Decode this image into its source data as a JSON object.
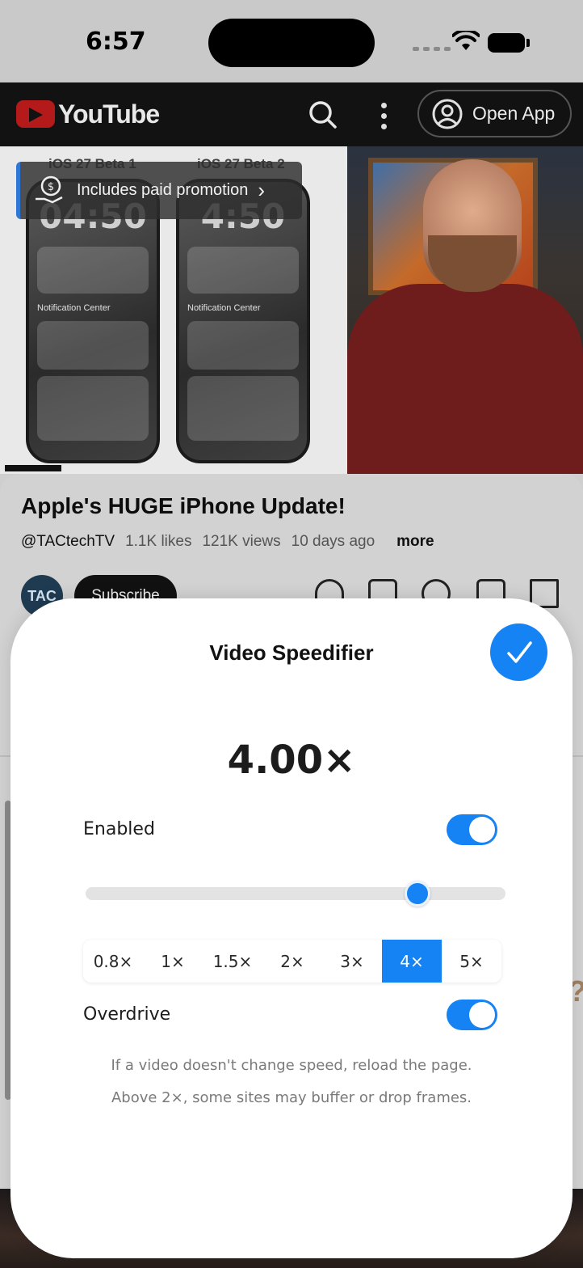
{
  "status_bar": {
    "time": "6:57"
  },
  "youtube": {
    "logo_text": "YouTube",
    "open_app_label": "Open App"
  },
  "video": {
    "promo_label": "Includes paid promotion",
    "phone_left_label": "iOS 27 Beta 1",
    "phone_right_label": "iOS 27 Beta 2",
    "phone_left_time": "04:50",
    "phone_right_time": "4:50",
    "notification_center": "Notification Center"
  },
  "video_info": {
    "title": "Apple's HUGE iPhone Update!",
    "channel": "@TACtechTV",
    "likes": "1.1K likes",
    "views": "121K views",
    "age": "10 days ago",
    "more_label": "more",
    "avatar_text": "TAC",
    "subscribe_label": "Subscribe"
  },
  "speedifier": {
    "title": "Video Speedifier",
    "speed_display": "4.00×",
    "enabled_label": "Enabled",
    "enabled": true,
    "slider_value": 4.0,
    "slider_min": 0.25,
    "slider_max": 5.0,
    "presets": [
      {
        "label": "0.8×",
        "active": false
      },
      {
        "label": "1×",
        "active": false
      },
      {
        "label": "1.5×",
        "active": false
      },
      {
        "label": "2×",
        "active": false
      },
      {
        "label": "3×",
        "active": false
      },
      {
        "label": "4×",
        "active": true
      },
      {
        "label": "5×",
        "active": false
      }
    ],
    "overdrive_label": "Overdrive",
    "overdrive": true,
    "hint_1": "If a video doesn't change speed, reload the page.",
    "hint_2": "Above 2×, some sites may buffer or drop frames."
  },
  "colors": {
    "accent": "#1583f4",
    "youtube_red": "#ff0000"
  }
}
